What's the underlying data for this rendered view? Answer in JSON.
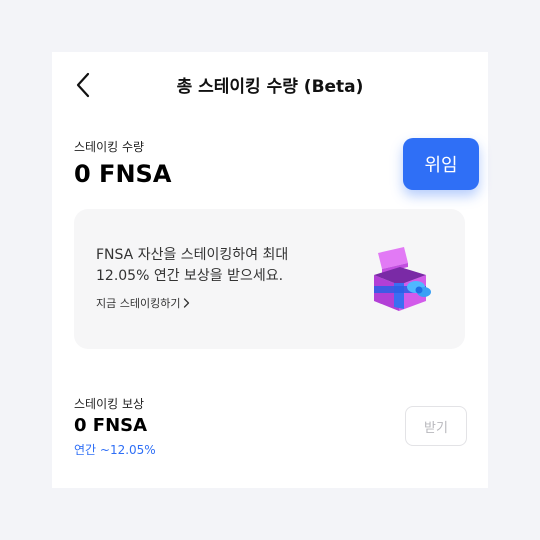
{
  "header": {
    "title": "총 스테이킹 수량 (Beta)"
  },
  "staking": {
    "label": "스테이킹 수량",
    "amount": "0 FNSA",
    "delegate_label": "위임"
  },
  "promo": {
    "line1": "FNSA 자산을 스테이킹하여 최대",
    "line2": "12.05% 연간 보상을 받으세요.",
    "link_label": "지금 스테이킹하기",
    "icon": "gift-box-icon"
  },
  "rewards": {
    "label": "스테이킹 보상",
    "amount": "0 FNSA",
    "apr": "연간 ~12.05%",
    "claim_label": "받기"
  },
  "colors": {
    "accent": "#2f6ff6",
    "background": "#f3f4f8",
    "card": "#ffffff",
    "promo_bg": "#f6f6f7"
  }
}
